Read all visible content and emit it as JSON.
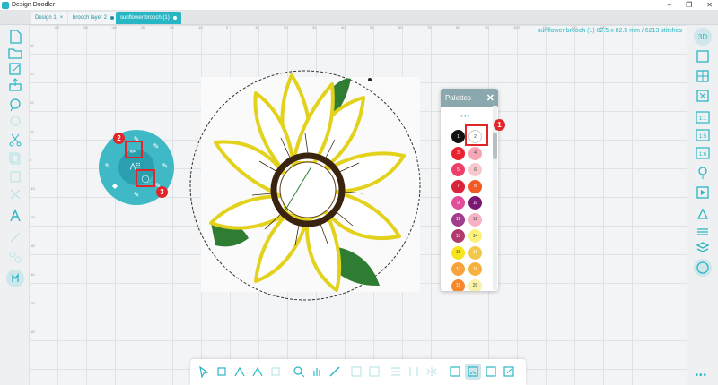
{
  "app": {
    "title": "Design Doodler"
  },
  "tabs": [
    {
      "label": "Design 1",
      "suffix": "×"
    },
    {
      "label": "brooch layer 2",
      "suffix": ""
    },
    {
      "label": "sunflower brooch (1)",
      "suffix": ""
    }
  ],
  "design_info": "sunflower brooch (1)   82.5 x 82.5 mm / 6213 stitches",
  "ruler_top": [
    "-60",
    "-50",
    "-40",
    "-30",
    "-20",
    "-10",
    "0",
    "10",
    "20",
    "30",
    "40",
    "50",
    "60",
    "70",
    "80",
    "90",
    "100",
    "110",
    "120",
    "130"
  ],
  "ruler_left": [
    "40",
    "30",
    "20",
    "10",
    "0",
    "-10",
    "-20",
    "-30",
    "-40",
    "-50",
    "-60"
  ],
  "palettes": {
    "title": "Palettes",
    "close": "✕",
    "more": "•••",
    "swatches": [
      {
        "num": "1",
        "color": "#111111"
      },
      {
        "num": "2",
        "color": "#ffffff"
      },
      {
        "num": "3",
        "color": "#e8232f"
      },
      {
        "num": "4",
        "color": "#f7a6b6"
      },
      {
        "num": "5",
        "color": "#ee3f6a"
      },
      {
        "num": "6",
        "color": "#f7c9cf"
      },
      {
        "num": "7",
        "color": "#d8243a"
      },
      {
        "num": "8",
        "color": "#f15a24"
      },
      {
        "num": "9",
        "color": "#e04e9a"
      },
      {
        "num": "10",
        "color": "#7b1873"
      },
      {
        "num": "11",
        "color": "#a23c8c"
      },
      {
        "num": "12",
        "color": "#f6b1c3"
      },
      {
        "num": "13",
        "color": "#b03a6b"
      },
      {
        "num": "14",
        "color": "#fbf27a"
      },
      {
        "num": "15",
        "color": "#f6e51d"
      },
      {
        "num": "16",
        "color": "#f2c84b"
      },
      {
        "num": "17",
        "color": "#f7a23a"
      },
      {
        "num": "18",
        "color": "#f9b13d"
      },
      {
        "num": "19",
        "color": "#f5872c"
      },
      {
        "num": "20",
        "color": "#f8f1a8"
      }
    ]
  },
  "annotations": [
    {
      "label": "1"
    },
    {
      "label": "2"
    },
    {
      "label": "3"
    }
  ],
  "radial_menu": {
    "items": [
      "pencil-tool",
      "circle-tool",
      "multi-select-tool",
      "grid-tool"
    ]
  },
  "colors": {
    "accent": "#29b6c4",
    "highlight": "#e0262b",
    "petal_yellow": "#e3d21c",
    "center_brown": "#3a2410",
    "leaf_green": "#2e7d32"
  },
  "right_tools": [
    "3D",
    "□",
    "⊞",
    "▭",
    "1:1",
    "1:5",
    "1:6",
    "",
    "",
    "",
    "",
    ""
  ],
  "more_menu": "•••"
}
